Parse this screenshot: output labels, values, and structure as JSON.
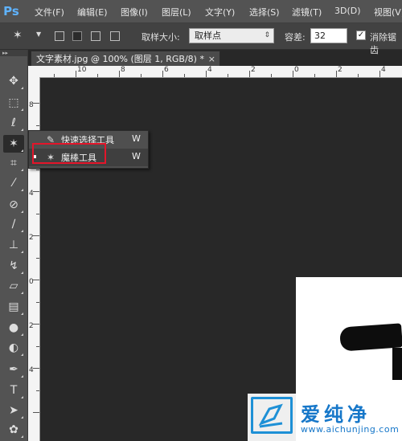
{
  "app": {
    "logo": "Ps"
  },
  "menu": [
    "文件(F)",
    "编辑(E)",
    "图像(I)",
    "图层(L)",
    "文字(Y)",
    "选择(S)",
    "滤镜(T)",
    "3D(D)",
    "视图(V)"
  ],
  "options": {
    "sample_size_label": "取样大小:",
    "sample_size_value": "取样点",
    "tolerance_label": "容差:",
    "tolerance_value": "32",
    "antialias_label": "消除锯齿",
    "antialias_checked": true
  },
  "document": {
    "tab_title": "文字素材.jpg @ 100% (图层 1, RGB/8) *",
    "close": "×"
  },
  "ruler_top_labels": [
    "10",
    "8",
    "6",
    "4",
    "2",
    "0",
    "2",
    "4"
  ],
  "ruler_left_labels": [
    "8",
    "6",
    "4",
    "2",
    "0",
    "2",
    "4"
  ],
  "tools": [
    "move-tool",
    "marquee-tool",
    "lasso-tool",
    "magic-wand-tool",
    "crop-tool",
    "eyedropper-tool",
    "healing-brush-tool",
    "brush-tool",
    "clone-stamp-tool",
    "history-brush-tool",
    "eraser-tool",
    "gradient-tool",
    "blur-tool",
    "dodge-tool",
    "pen-tool",
    "type-tool",
    "path-selection-tool",
    "shape-tool"
  ],
  "flyout": {
    "items": [
      {
        "label": "快速选择工具",
        "shortcut": "W",
        "icon": "quick-selection-icon",
        "active": false
      },
      {
        "label": "魔棒工具",
        "shortcut": "W",
        "icon": "magic-wand-icon",
        "active": true
      }
    ]
  },
  "watermark": {
    "title": "爱纯净",
    "url": "www.aichunjing.com"
  },
  "colors": {
    "menubar": "#535353",
    "optbar": "#424242",
    "canvas_bg": "#282828",
    "highlight": "#e3152a",
    "watermark_blue": "#1677c9"
  }
}
